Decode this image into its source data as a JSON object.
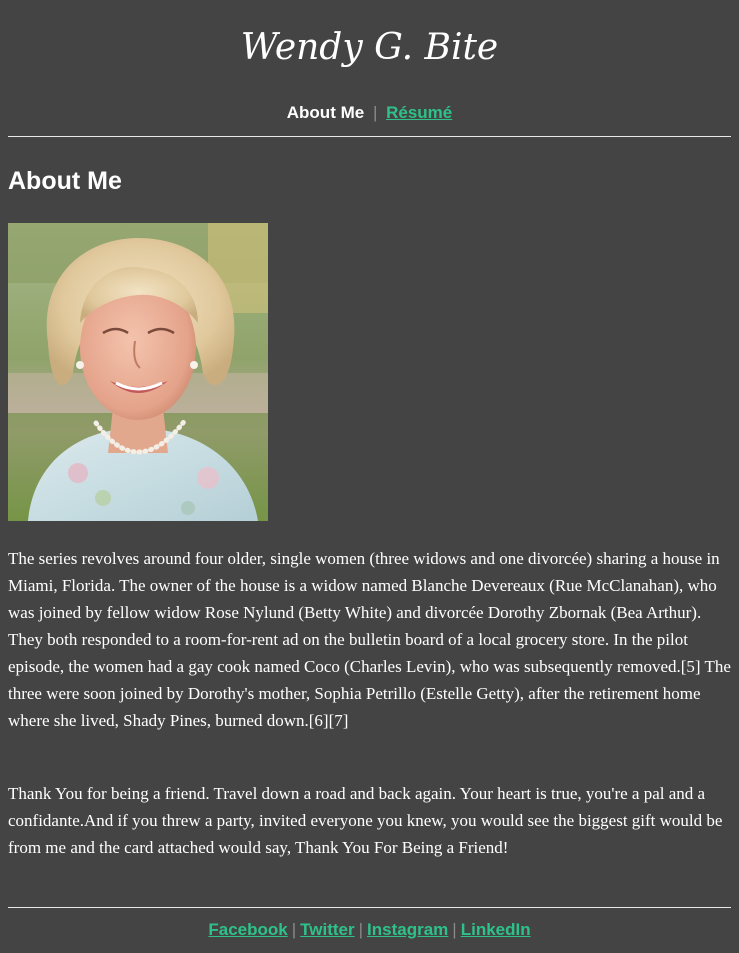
{
  "site": {
    "title": "Wendy G. Bite"
  },
  "nav": {
    "current_label": "About Me",
    "separator": "|",
    "resume_label": "Résumé"
  },
  "main": {
    "heading": "About Me",
    "portrait_alt": "Portrait photo",
    "paragraphs": [
      "The series revolves around four older, single women (three widows and one divorcée) sharing a house in Miami, Florida. The owner of the house is a widow named Blanche Devereaux (Rue McClanahan), who was joined by fellow widow Rose Nylund (Betty White) and divorcée Dorothy Zbornak (Bea Arthur). They both responded to a room-for-rent ad on the bulletin board of a local grocery store. In the pilot episode, the women had a gay cook named Coco (Charles Levin), who was subsequently removed.[5] The three were soon joined by Dorothy's mother, Sophia Petrillo (Estelle Getty), after the retirement home where she lived, Shady Pines, burned down.[6][7]",
      "Thank You for being a friend. Travel down a road and back again. Your heart is true, you're a pal and a confidante.And if you threw a party, invited everyone you knew, you would see the biggest gift would be from me and the card attached would say, Thank You For Being a Friend!"
    ]
  },
  "footer": {
    "links": [
      "Facebook",
      "Twitter",
      "Instagram",
      "LinkedIn"
    ],
    "separator": "|"
  },
  "colors": {
    "background": "#444444",
    "text": "#ffffff",
    "link": "#2ec28a",
    "separator": "#8a8a8a"
  }
}
